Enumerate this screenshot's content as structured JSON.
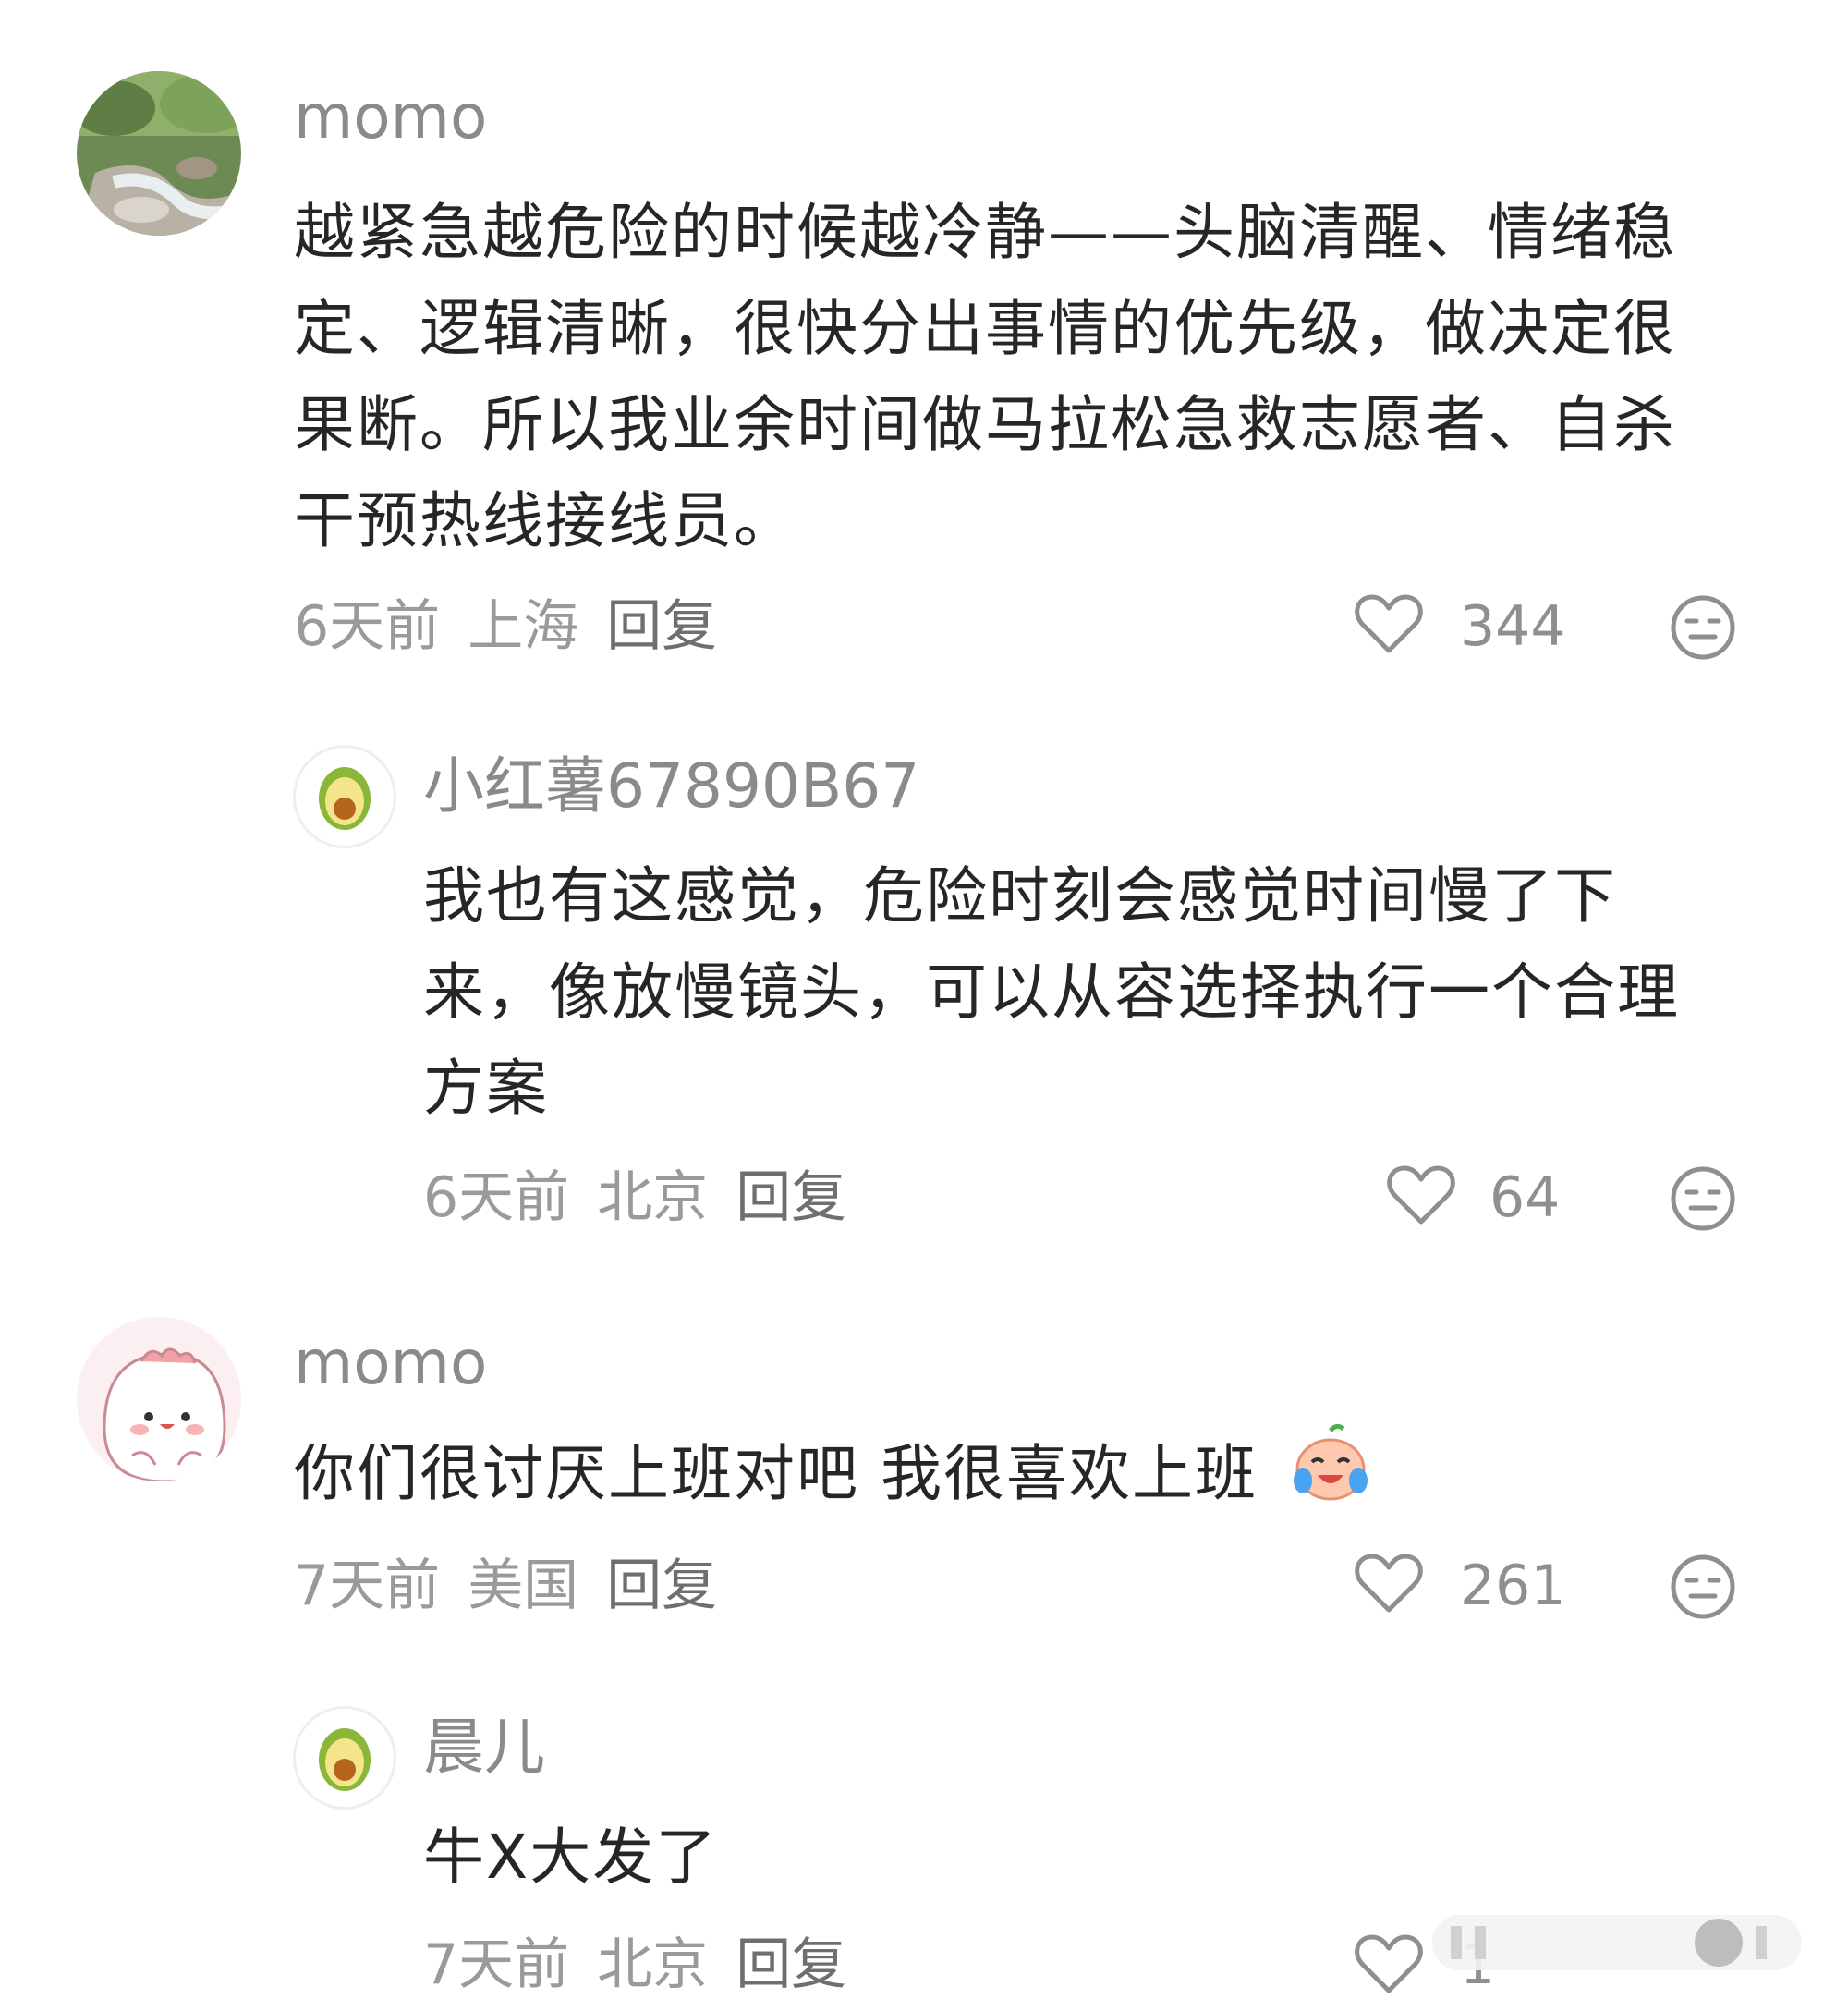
{
  "comments": [
    {
      "username": "momo",
      "text": "越紧急越危险的时候越冷静——头脑清醒、情绪稳定、逻辑清晰，很快分出事情的优先级，做决定很果断。所以我业余时间做马拉松急救志愿者、自杀干预热线接线员。",
      "time": "6天前",
      "location": "上海",
      "reply_label": "回复",
      "likes": "344",
      "replies": [
        {
          "username": "小红薯67890B67",
          "text": "我也有这感觉，危险时刻会感觉时间慢了下来，像放慢镜头，可以从容选择执行一个合理方案",
          "time": "6天前",
          "location": "北京",
          "reply_label": "回复",
          "likes": "64"
        }
      ]
    },
    {
      "username": "momo",
      "text": "你们很讨厌上班对吧 我很喜欢上班",
      "time": "7天前",
      "location": "美国",
      "reply_label": "回复",
      "likes": "261",
      "replies": [
        {
          "username": "晨儿",
          "text": "牛X大发了",
          "time": "7天前",
          "location": "北京",
          "reply_label": "回复",
          "likes": "1"
        }
      ]
    }
  ],
  "icons": {
    "like": "heart-outline-icon",
    "dislike": "meh-face-icon",
    "default_avatar": "avocado-icon",
    "emoji": "crying-laughing-peach-emoji"
  },
  "colors": {
    "username": "#8a8a8a",
    "text": "#262626",
    "meta": "#9a9a9a",
    "icon": "#8f8f8f"
  }
}
